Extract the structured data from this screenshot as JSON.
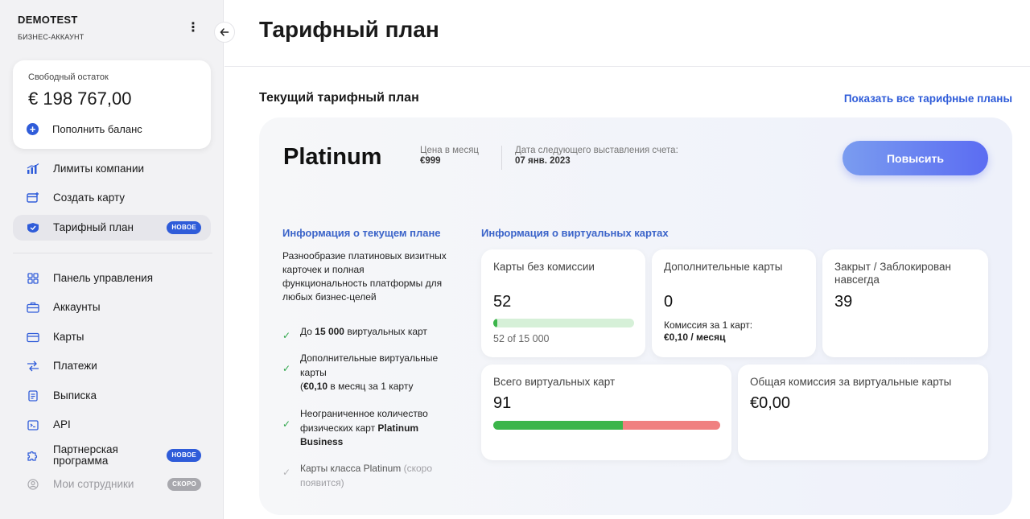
{
  "account": {
    "name": "DEMOTEST",
    "type": "БИЗНЕС-АККАУНТ"
  },
  "balance": {
    "label": "Свободный остаток",
    "value": "€ 198 767,00",
    "topup_label": "Пополнить баланс"
  },
  "sidebar": {
    "items": [
      {
        "label": "Лимиты компании",
        "icon": "chart-icon"
      },
      {
        "label": "Создать карту",
        "icon": "card-plus-icon"
      },
      {
        "label": "Тарифный план",
        "icon": "plan-icon",
        "badge": "НОВОЕ",
        "active": true
      },
      {
        "label": "Панель управления",
        "icon": "grid-icon"
      },
      {
        "label": "Аккаунты",
        "icon": "briefcase-icon"
      },
      {
        "label": "Карты",
        "icon": "card-icon"
      },
      {
        "label": "Платежи",
        "icon": "transfer-icon"
      },
      {
        "label": "Выписка",
        "icon": "document-icon"
      },
      {
        "label": "API",
        "icon": "terminal-icon"
      },
      {
        "label": "Партнерская\nпрограмма",
        "icon": "puzzle-icon",
        "badge": "НОВОЕ"
      },
      {
        "label": "Мои сотрудники",
        "icon": "user-icon",
        "badge": "СКОРО",
        "disabled": true
      }
    ]
  },
  "page": {
    "title": "Тарифный план"
  },
  "current_plan": {
    "section_title": "Текущий тарифный план",
    "show_all_link": "Показать все тарифные планы",
    "plan_name": "Platinum",
    "price_label": "Цена в месяц",
    "price_value": "€999",
    "next_invoice_label": "Дата следующего выставления счета:",
    "next_invoice_value": "07 янв. 2023",
    "upgrade_button": "Повысить"
  },
  "plan_info": {
    "title": "Информация о текущем плане",
    "description": "Разнообразие платиновых визитных карточек и полная функциональность платформы для любых бизнес-целей",
    "features": [
      {
        "pre": "До ",
        "bold": "15 000",
        "post": " виртуальных карт"
      },
      {
        "line1": "Дополнительные виртуальные карты",
        "line2_open": "(",
        "line2_bold": "€0,10",
        "line2_rest": " в месяц за 1 карту"
      },
      {
        "pre": "Неограниченное количество физических карт ",
        "bold": "Platinum Business",
        "post": ""
      },
      {
        "pre": "Карты класса Platinum ",
        "muted": "(скоро появится)"
      }
    ]
  },
  "virtual_cards": {
    "title": "Информация о виртуальных картах",
    "free_cards": {
      "label": "Карты без комиссии",
      "value": "52",
      "sub": "52 of 15 000",
      "used": 52,
      "limit": 15000
    },
    "extra_cards": {
      "label": "Дополнительные карты",
      "value": "0",
      "commission_label": "Комиссия за 1 карт:",
      "commission_value": "€0,10 / месяц"
    },
    "closed_cards": {
      "label": "Закрыт / Заблокирован навсегда",
      "value": "39"
    },
    "total_cards": {
      "label": "Всего виртуальных карт",
      "value": "91",
      "active": 52,
      "closed": 39
    },
    "total_commission": {
      "label": "Общая комиссия за виртуальные карты",
      "value": "€0,00"
    }
  }
}
